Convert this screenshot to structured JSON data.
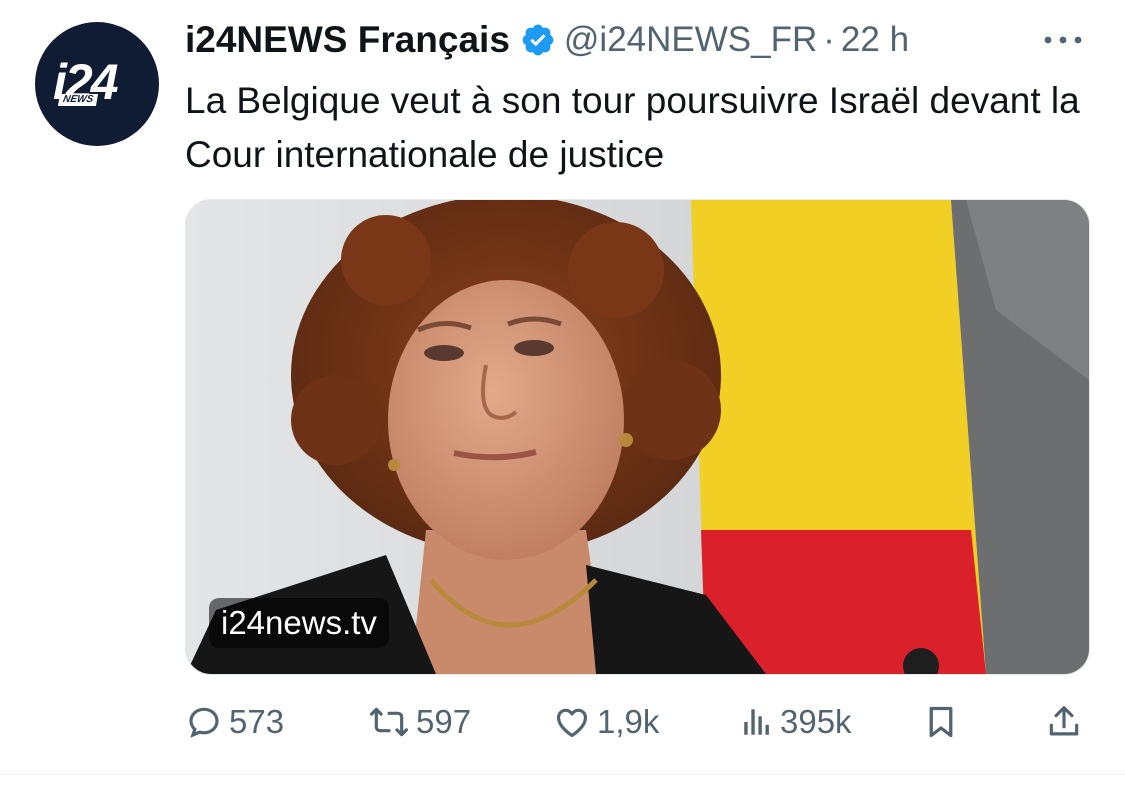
{
  "account": {
    "avatar_icon": "i24news-logo",
    "avatar_text": "i24",
    "avatar_subtext": "NEWS",
    "name": "i24NEWS Français",
    "verified_icon": "verified-badge-icon",
    "handle": "@i24NEWS_FR",
    "separator": "·",
    "time": "22 h"
  },
  "tweet": {
    "text": "La Belgique veut à son tour poursuivre Israël devant la Cour internationale de justice"
  },
  "media": {
    "link_label": "i24news.tv"
  },
  "actions": {
    "replies": "573",
    "retweets": "597",
    "likes": "1,9k",
    "views": "395k"
  },
  "icons": {
    "more": "more-dots-icon",
    "reply": "reply-icon",
    "retweet": "retweet-icon",
    "like": "heart-icon",
    "views": "views-icon",
    "bookmark": "bookmark-icon",
    "share": "share-icon"
  },
  "colors": {
    "primary_text": "#0f1419",
    "secondary_text": "#536471",
    "verified": "#1d9bf0",
    "avatar_bg": "#101c34"
  }
}
